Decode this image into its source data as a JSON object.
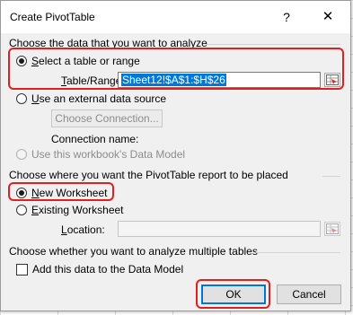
{
  "dialog": {
    "title": "Create PivotTable",
    "help_glyph": "?",
    "close_glyph": "✕"
  },
  "data_section": {
    "heading": "Choose the data that you want to analyze",
    "select_table_prefix": "",
    "select_table_accel": "S",
    "select_table_rest": "elect a table or range",
    "table_range_accel": "T",
    "table_range_rest": "able/Range:",
    "table_range_value": "Sheet12!$A$1:$H$26",
    "external_accel": "U",
    "external_rest": "se an external data source",
    "choose_connection": "Choose Connection...",
    "connection_name": "Connection name:",
    "data_model": "Use this workbook's Data Model",
    "selected": "select_table"
  },
  "placement_section": {
    "heading": "Choose where you want the PivotTable report to be placed",
    "new_ws_accel": "N",
    "new_ws_rest": "ew Worksheet",
    "existing_accel": "E",
    "existing_rest": "xisting Worksheet",
    "location_accel": "L",
    "location_rest": "ocation:",
    "location_value": "",
    "selected": "new_worksheet"
  },
  "multi_section": {
    "heading": "Choose whether you want to analyze multiple tables",
    "add_data_model": "Add this data to the Data Model",
    "add_data_model_checked": false
  },
  "buttons": {
    "ok": "OK",
    "cancel": "Cancel"
  },
  "colors": {
    "highlight": "#e02020",
    "selection": "#0078d7"
  }
}
